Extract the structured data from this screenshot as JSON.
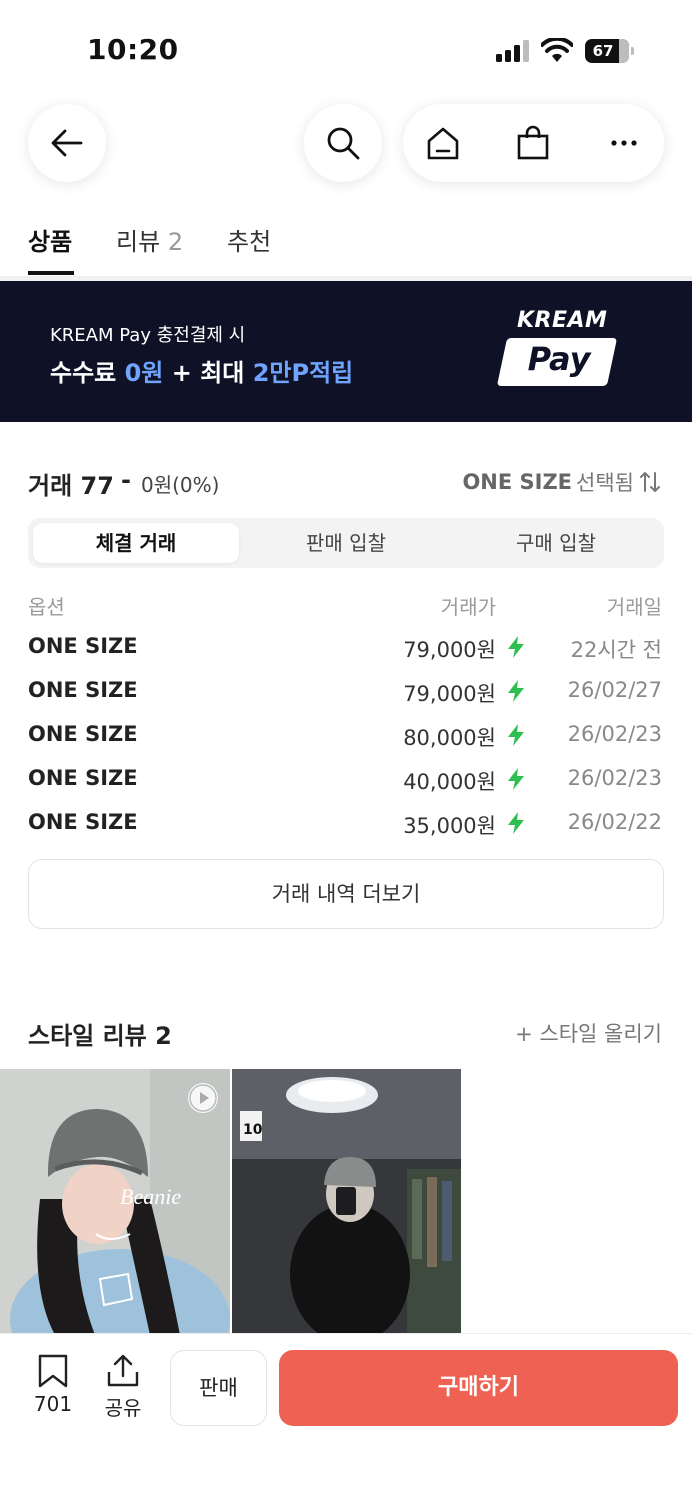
{
  "status_bar": {
    "time": "10:20",
    "battery": "67"
  },
  "tabs": [
    {
      "label": "상품"
    },
    {
      "label": "리뷰",
      "count": "2"
    },
    {
      "label": "추천"
    }
  ],
  "banner": {
    "line1": "KREAM Pay 충전결제 시",
    "line2_a": "수수료 ",
    "line2_b": "0원",
    "line2_c": " + 최대 ",
    "line2_d": "2만P적립",
    "brand": "KREAM",
    "brand_pay": "Pay"
  },
  "trades": {
    "title": "거래 77",
    "dash": "-",
    "summary": "0원(0%)",
    "size_value": "ONE SIZE",
    "size_suffix": "선택됨",
    "segments": [
      "체결 거래",
      "판매 입찰",
      "구매 입찰"
    ],
    "headers": {
      "option": "옵션",
      "price": "거래가",
      "date": "거래일"
    },
    "rows": [
      {
        "option": "ONE SIZE",
        "price": "79,000원",
        "date": "22시간 전"
      },
      {
        "option": "ONE SIZE",
        "price": "79,000원",
        "date": "26/02/27"
      },
      {
        "option": "ONE SIZE",
        "price": "80,000원",
        "date": "26/02/23"
      },
      {
        "option": "ONE SIZE",
        "price": "40,000원",
        "date": "26/02/23"
      },
      {
        "option": "ONE SIZE",
        "price": "35,000원",
        "date": "26/02/22"
      }
    ],
    "more_label": "거래 내역 더보기"
  },
  "style_review": {
    "title": "스타일 리뷰 2",
    "upload_label": "+ 스타일 올리기",
    "photo1_overlay": "Beanie",
    "photo2_sign": "10"
  },
  "bottom_bar": {
    "bookmark_count": "701",
    "share_label": "공유",
    "sell_label": "판매",
    "buy_label": "구매하기"
  },
  "colors": {
    "accent_buy": "#ef6253",
    "banner_bg": "#0f1226",
    "banner_highlight": "#6fa4ff",
    "bolt": "#2ec04f"
  }
}
